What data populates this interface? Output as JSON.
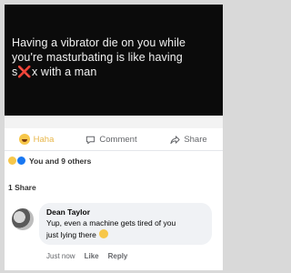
{
  "post": {
    "text_lines": [
      "Having a vibrator die on you while",
      "you're masturbating is like having",
      "s❌x with a man"
    ]
  },
  "actions": {
    "haha_label": "Haha",
    "comment_label": "Comment",
    "share_label": "Share"
  },
  "reactions": {
    "summary": "You and 9 others"
  },
  "shares": {
    "count_label": "1 Share"
  },
  "comment": {
    "author": "Dean Taylor",
    "text_line1": "Yup, even a machine gets tired of you",
    "text_line2": "just lying there",
    "time": "Just now",
    "like_label": "Like",
    "reply_label": "Reply"
  },
  "colors": {
    "haha_accent": "#e8b64a",
    "secondary_text": "#65676b",
    "post_background": "#0b0b0b"
  }
}
